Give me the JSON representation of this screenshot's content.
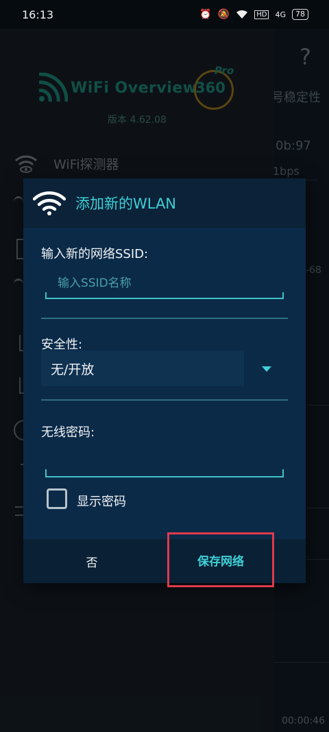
{
  "status": {
    "time": "16:13",
    "network": "4G",
    "hd": "HD",
    "battery": "78"
  },
  "background": {
    "help": "?",
    "col_header": "号稳定性",
    "mac_fragment": "0b:97",
    "speed_fragment": "1bps",
    "signal_fragment": "-68",
    "timer": "00:00:46"
  },
  "drawer": {
    "logo_text": "WiFi Overview",
    "logo_360": "360",
    "logo_pro": "Pro",
    "version": "版本 4.62.08",
    "item_detector": "WiFi探测器"
  },
  "dialog": {
    "title": "添加新的WLAN",
    "ssid_label": "输入新的网络SSID:",
    "ssid_placeholder": "输入SSID名称",
    "security_label": "安全性:",
    "security_value": "无/开放",
    "password_label": "无线密码:",
    "show_password_label": "显示密码",
    "cancel_label": "否",
    "save_label": "保存网络"
  },
  "colors": {
    "accent": "#3fd0d8",
    "highlight": "#e0394c",
    "dialog_bg": "#0b2a48"
  }
}
